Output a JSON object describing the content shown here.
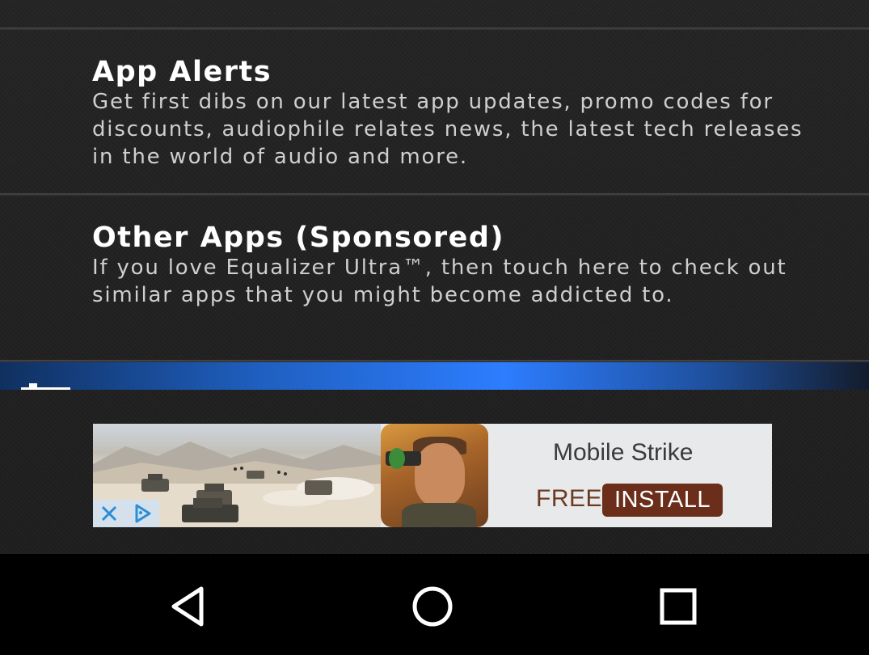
{
  "settings": {
    "items": [
      {
        "title": "App Alerts",
        "description": "Get first dibs on our latest app updates, promo codes for discounts, audiophile relates news, the latest tech releases in the world of audio and more."
      },
      {
        "title": "Other Apps (Sponsored)",
        "description": "If you love Equalizer Ultra™, then touch here to check out similar apps that you might become addicted to."
      }
    ]
  },
  "ad": {
    "title": "Mobile Strike",
    "price_label": "FREE",
    "install_label": "INSTALL",
    "icons": [
      "close-icon",
      "adchoices-icon"
    ]
  },
  "nav": {
    "icons": [
      "back-icon",
      "home-icon",
      "recents-icon"
    ]
  },
  "colors": {
    "accent_blue": "#2d7dff",
    "install_button": "#6b2e1b",
    "price_text": "#6b3a21"
  }
}
